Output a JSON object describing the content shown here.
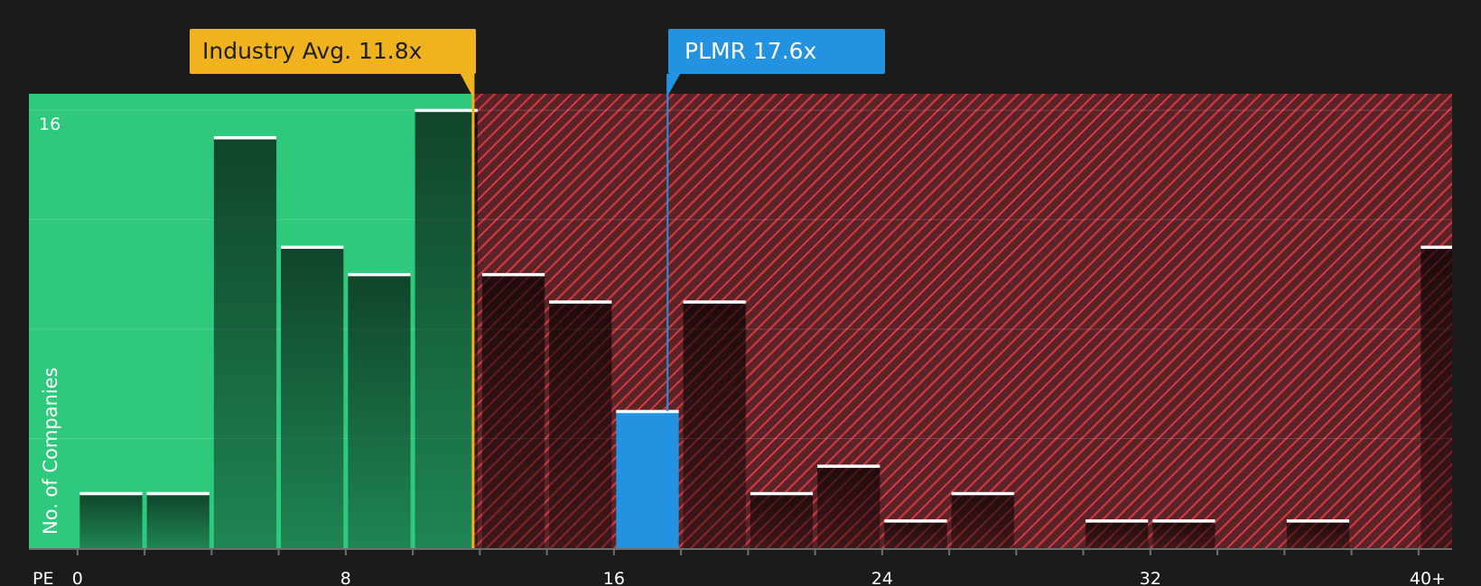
{
  "chart_data": {
    "type": "bar",
    "title": "",
    "xlabel": "PE",
    "ylabel": "No. of Companies",
    "ylim": [
      0,
      16.6
    ],
    "xlim": [
      -1.45,
      41.0
    ],
    "grid": true,
    "y_ticks": [
      16
    ],
    "y_tick_labels": [
      "16"
    ],
    "x_ticks": [
      0,
      8,
      16,
      24,
      32,
      40
    ],
    "x_tick_labels": [
      "0",
      "8",
      "16",
      "24",
      "32",
      "40+"
    ],
    "bin_width": 2,
    "bins": [
      {
        "x0": 0,
        "value": 2
      },
      {
        "x0": 2,
        "value": 2
      },
      {
        "x0": 4,
        "value": 15
      },
      {
        "x0": 6,
        "value": 11
      },
      {
        "x0": 8,
        "value": 10
      },
      {
        "x0": 10,
        "value": 16
      },
      {
        "x0": 12,
        "value": 10
      },
      {
        "x0": 14,
        "value": 9
      },
      {
        "x0": 16,
        "value": 5,
        "highlight": true
      },
      {
        "x0": 18,
        "value": 9
      },
      {
        "x0": 20,
        "value": 2
      },
      {
        "x0": 22,
        "value": 3
      },
      {
        "x0": 24,
        "value": 1
      },
      {
        "x0": 26,
        "value": 2
      },
      {
        "x0": 30,
        "value": 1
      },
      {
        "x0": 32,
        "value": 1
      },
      {
        "x0": 36,
        "value": 1
      },
      {
        "x0": 40,
        "value": 11
      }
    ],
    "industry_avg": {
      "value": 11.8,
      "label": "Industry Avg. 11.8x"
    },
    "company": {
      "value": 17.6,
      "label": "PLMR 17.6x"
    },
    "colors": {
      "background": "#1b1b1b",
      "undervalued_zone": "#2ec97d",
      "overvalued_zone": "#5a2328",
      "hatch": "#d9393f",
      "bar": "#1f1f1f",
      "bar_top": "#ffffff",
      "highlight_bar": "#2392e0",
      "industry": "#f0b31e",
      "company": "#2392e0",
      "text": "#ffffff"
    }
  }
}
